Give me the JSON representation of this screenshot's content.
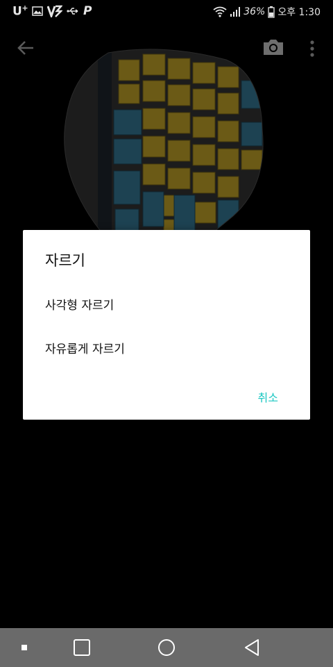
{
  "status_bar": {
    "carrier": "U",
    "carrier_sup": "+",
    "left_icons": [
      "image-icon",
      "v-flash-icon",
      "usb-icon",
      "p-icon"
    ],
    "p_label": "P",
    "battery_percent": "36%",
    "time": "오후 1:30",
    "right_icons": [
      "wifi-icon",
      "signal-icon",
      "battery-icon"
    ]
  },
  "app_bar": {
    "back_icon": "arrow-left-icon",
    "camera_icon": "camera-icon",
    "more_icon": "more-vertical-icon"
  },
  "dialog": {
    "title": "자르기",
    "options": [
      {
        "label": "사각형 자르기"
      },
      {
        "label": "자유롭게 자르기"
      }
    ],
    "cancel_label": "취소",
    "accent": "#19c7c2"
  },
  "nav_bar": {
    "buttons": [
      "dot-icon",
      "recents-square-icon",
      "home-circle-icon",
      "back-triangle-icon"
    ],
    "background": "#6a6a6a"
  }
}
